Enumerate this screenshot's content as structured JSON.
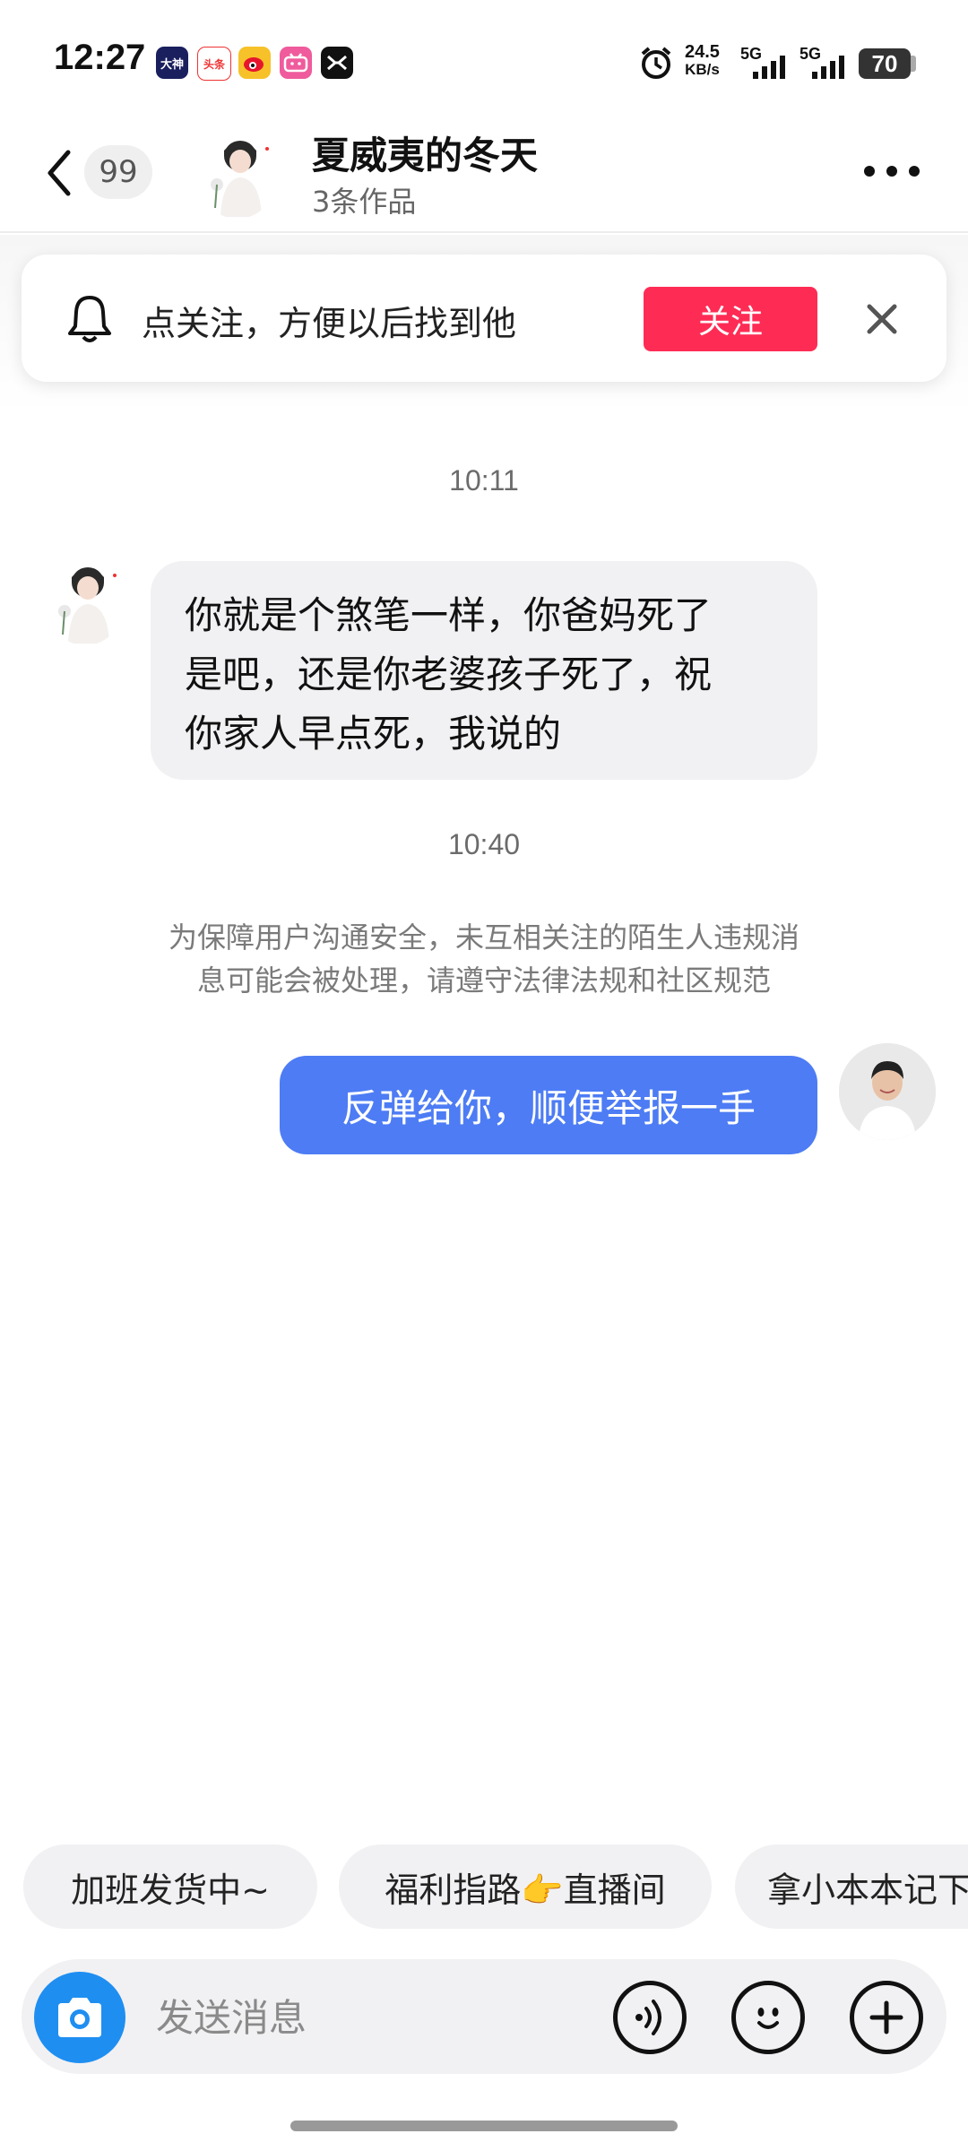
{
  "status_bar": {
    "time": "12:27",
    "apps": [
      "大神",
      "头条",
      "微博",
      "bilibili",
      "X"
    ],
    "net_speed_value": "24.5",
    "net_speed_unit": "KB/s",
    "signal1_label": "5G",
    "signal2_label": "5G",
    "battery": "70"
  },
  "header": {
    "unread_count": "99",
    "contact_name": "夏威夷的冬天",
    "contact_subtitle": "3条作品"
  },
  "follow_banner": {
    "text": "点关注，方便以后找到他",
    "follow_label": "关注"
  },
  "messages": {
    "time1": "10:11",
    "incoming_line1": "你就是个煞笔一样，你爸妈死了",
    "incoming_line2": "是吧，还是你老婆孩子死了，祝",
    "incoming_line3": "你家人早点死，我说的",
    "time2": "10:40",
    "notice_line1": "为保障用户沟通安全，未互相关注的陌生人违规消",
    "notice_line2": "息可能会被处理，请遵守法律法规和社区规范",
    "outgoing": "反弹给你，顺便举报一手"
  },
  "quick_replies": [
    "加班发货中~",
    "福利指路👉直播间",
    "拿小本本记下"
  ],
  "input": {
    "placeholder": "发送消息"
  },
  "colors": {
    "follow_button": "#fe2c55",
    "outgoing_bubble": "#4d7cf4",
    "camera_button": "#1f8ef1"
  }
}
